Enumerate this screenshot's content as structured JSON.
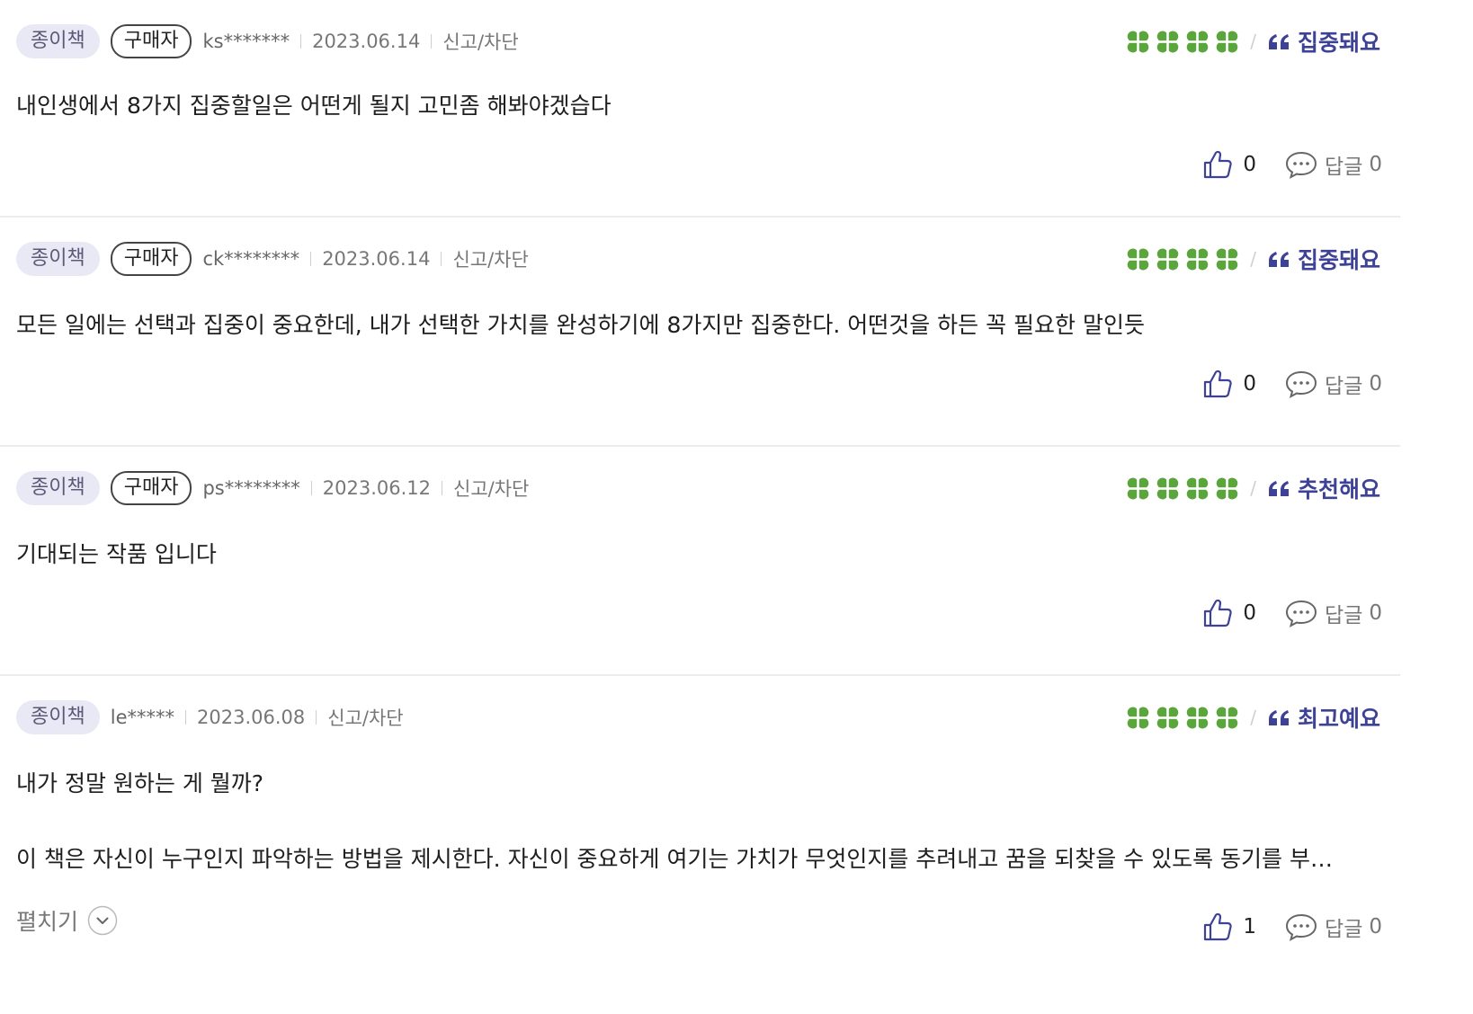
{
  "colors": {
    "accent": "#3e4296",
    "clover": "#5aa53c",
    "badge_bg": "#e9e9f6"
  },
  "reviews": [
    {
      "type_badge": "종이책",
      "buyer_badge": "구매자",
      "user": "ks*******",
      "date": "2023.06.14",
      "report": "신고/차단",
      "rating_clovers": 4,
      "tag": "집중돼요",
      "text": "내인생에서 8가지 집중할일은 어떤게 될지 고민좀 해봐야겠습다",
      "likes": "0",
      "reply_label": "답글",
      "reply_count": "0"
    },
    {
      "type_badge": "종이책",
      "buyer_badge": "구매자",
      "user": "ck********",
      "date": "2023.06.14",
      "report": "신고/차단",
      "rating_clovers": 4,
      "tag": "집중돼요",
      "text": "모든 일에는 선택과 집중이 중요한데, 내가 선택한 가치를 완성하기에 8가지만 집중한다. 어떤것을 하든 꼭 필요한 말인듯",
      "likes": "0",
      "reply_label": "답글",
      "reply_count": "0"
    },
    {
      "type_badge": "종이책",
      "buyer_badge": "구매자",
      "user": "ps********",
      "date": "2023.06.12",
      "report": "신고/차단",
      "rating_clovers": 4,
      "tag": "추천해요",
      "text": "기대되는 작품 입니다",
      "likes": "0",
      "reply_label": "답글",
      "reply_count": "0"
    },
    {
      "type_badge": "종이책",
      "user": "le*****",
      "date": "2023.06.08",
      "report": "신고/차단",
      "rating_clovers": 4,
      "tag": "최고예요",
      "text": "내가 정말 원하는 게 뭘까?",
      "text_2": "이 책은 자신이 누구인지 파악하는 방법을 제시한다. 자신이 중요하게 여기는 가치가 무엇인지를 추려내고 꿈을 되찾을 수 있도록 동기를 부…",
      "expand_label": "펼치기",
      "likes": "1",
      "reply_label": "답글",
      "reply_count": "0"
    }
  ]
}
